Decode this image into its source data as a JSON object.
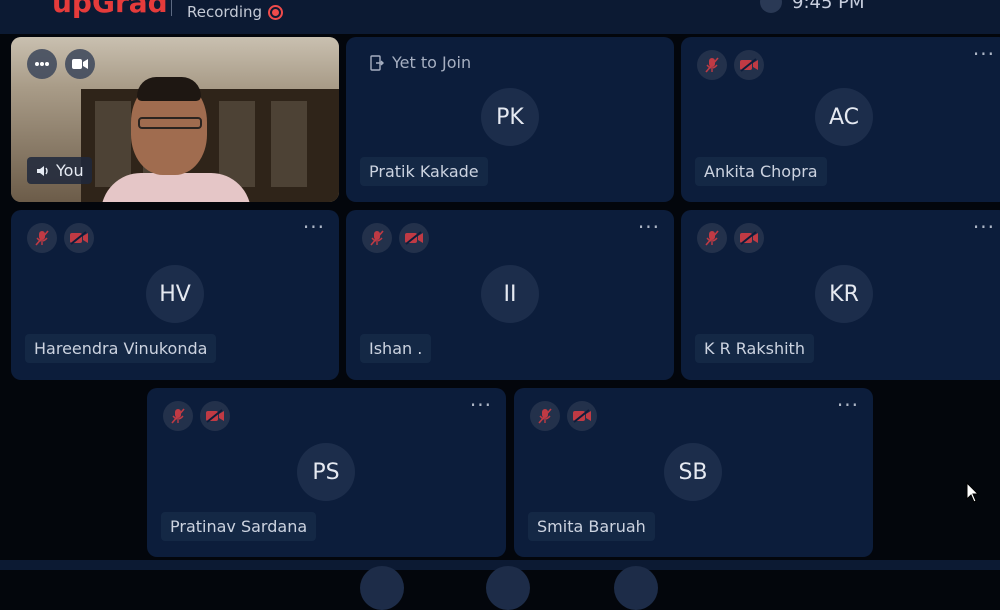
{
  "header": {
    "brand": "upGrad",
    "recording_label": "Recording",
    "clock_text": "9:45 PM"
  },
  "self_tile": {
    "label": "You"
  },
  "participants": [
    {
      "initials": "PK",
      "name": "Pratik Kakade",
      "status": "Yet to Join"
    },
    {
      "initials": "AC",
      "name": "Ankita Chopra"
    },
    {
      "initials": "HV",
      "name": "Hareendra Vinukonda"
    },
    {
      "initials": "II",
      "name": "Ishan ."
    },
    {
      "initials": "KR",
      "name": "K R Rakshith"
    },
    {
      "initials": "PS",
      "name": "Pratinav Sardana"
    },
    {
      "initials": "SB",
      "name": "Smita Baruah"
    }
  ],
  "icons": {
    "more": "more-options-icon",
    "mic": "mic-off-icon",
    "video": "video-off-icon"
  },
  "colors": {
    "accent_red": "#e53b3b",
    "tile_bg": "#0c1d3b",
    "muted_icon": "#c03a44"
  }
}
